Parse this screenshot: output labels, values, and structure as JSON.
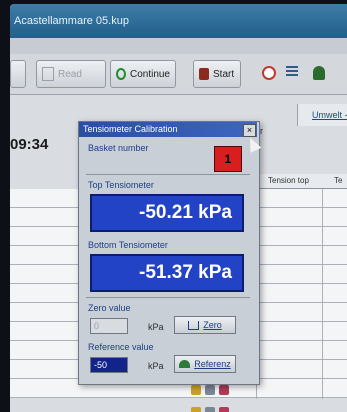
{
  "window": {
    "title": "Acastellammare 05.kup"
  },
  "toolbar": {
    "read_label": "Read",
    "continue_label": "Continue",
    "start_label": "Start"
  },
  "background": {
    "time": "09:34",
    "tab_umwelt": "Umwelt - G",
    "partial_label": "ber",
    "column_tension_top": "Tension top",
    "column_te": "Te"
  },
  "dialog": {
    "title": "Tensiometer Calibration",
    "close_symbol": "×",
    "basket_label": "Basket number",
    "basket_value": "1",
    "top_label": "Top Tensiometer",
    "top_value": "-50.21 kPa",
    "bottom_label": "Bottom Tensiometer",
    "bottom_value": "-51.37 kPa",
    "zero_label": "Zero value",
    "zero_value": "0",
    "zero_unit": "kPa",
    "zero_button": "Zero",
    "reference_label": "Reference value",
    "reference_value": "-50",
    "reference_unit": "kPa",
    "reference_button": "Referenz"
  },
  "colors": {
    "reading_bg": "#2343c6",
    "basket_bg": "#d81e1e",
    "title_bar": "#2a4f9f"
  }
}
